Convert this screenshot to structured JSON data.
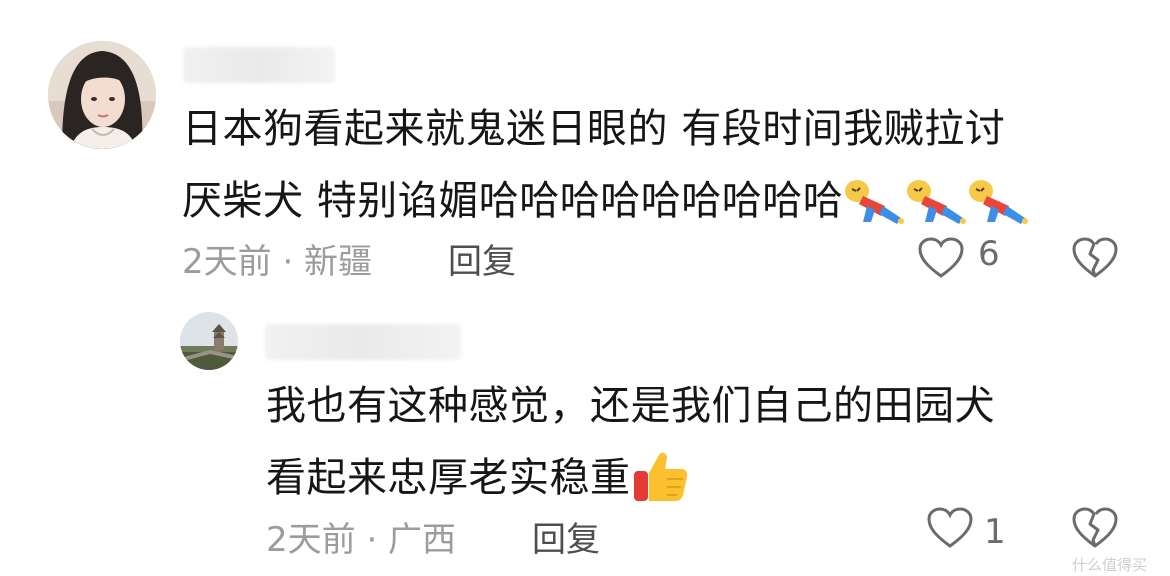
{
  "comments": [
    {
      "author": "",
      "lines": [
        "日本狗看起来就鬼迷日眼的 有段时间我贼拉讨",
        "厌柴犬 特别谄媚哈哈哈哈哈哈哈哈哈"
      ],
      "emoji": [
        "falling-person-icon",
        "falling-person-icon",
        "falling-person-icon"
      ],
      "time": "2天前",
      "location": "新疆",
      "meta": "2天前 · 新疆",
      "reply_label": "回复",
      "like_count": "6"
    },
    {
      "author": "",
      "lines": [
        "我也有这种感觉，还是我们自己的田园犬",
        "看起来忠厚老实稳重"
      ],
      "emoji": [
        "thumbs-up-icon"
      ],
      "time": "2天前",
      "location": "广西",
      "meta": "2天前 · 广西",
      "reply_label": "回复",
      "like_count": "1"
    }
  ],
  "watermark": "什么值得买",
  "colors": {
    "text": "#161616",
    "meta": "#9c9c9c",
    "reply": "#4e4e4e",
    "icon": "#6b6b6b"
  }
}
